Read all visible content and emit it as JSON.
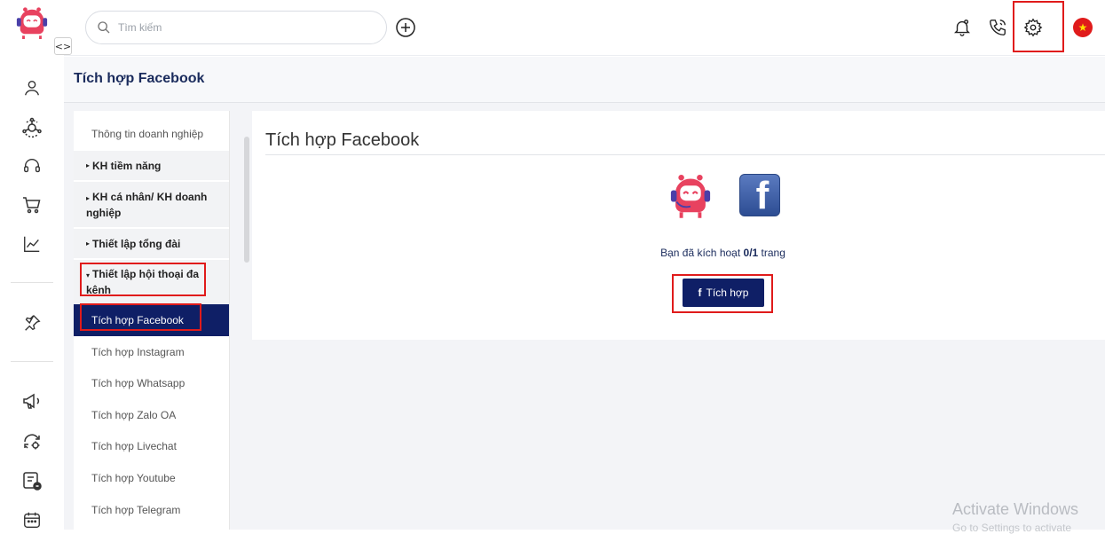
{
  "topbar": {
    "search_placeholder": "Tìm kiếm",
    "icons": [
      "notification-bell-icon",
      "phone-call-icon",
      "gear-icon"
    ],
    "language_flag": "★"
  },
  "rail": {
    "toggle": "<>",
    "icons": [
      "user-icon",
      "crm-network-icon",
      "headset-icon",
      "cart-icon",
      "analytics-icon",
      "pin-icon",
      "megaphone-icon",
      "sync-settings-icon",
      "ticket-icon",
      "calendar-icon"
    ]
  },
  "page": {
    "title": "Tích hợp Facebook"
  },
  "menu": {
    "items": [
      {
        "label": "Thông tin doanh nghiệp",
        "type": "item"
      },
      {
        "label": "KH tiềm năng",
        "type": "group",
        "caret": "▸"
      },
      {
        "label": "KH cá nhân/ KH doanh nghiệp",
        "type": "group",
        "caret": "▸"
      },
      {
        "label": "Thiết lập tổng đài",
        "type": "group",
        "caret": "▸"
      },
      {
        "label": "Thiết lập hội thoại đa kênh",
        "type": "group",
        "caret": "▾"
      },
      {
        "label": "Tích hợp Facebook",
        "type": "item",
        "active": true
      },
      {
        "label": "Tích hợp Instagram",
        "type": "item"
      },
      {
        "label": "Tích hợp Whatsapp",
        "type": "item"
      },
      {
        "label": "Tích hợp Zalo OA",
        "type": "item"
      },
      {
        "label": "Tích hợp Livechat",
        "type": "item"
      },
      {
        "label": "Tích hợp Youtube",
        "type": "item"
      },
      {
        "label": "Tích hợp Telegram",
        "type": "item"
      }
    ]
  },
  "card": {
    "title": "Tích hợp Facebook",
    "fb_letter": "f",
    "status_prefix": "Bạn đã kích hoạt ",
    "status_count": "0/1",
    "status_suffix": " trang",
    "button_icon": "f",
    "button_label": "Tích hợp"
  },
  "watermark": {
    "line1": "Activate Windows",
    "line2": "Go to Settings to activate"
  },
  "colors": {
    "primary": "#0f1f66",
    "brand_pink": "#e8425f",
    "highlight": "#e01b1b"
  }
}
